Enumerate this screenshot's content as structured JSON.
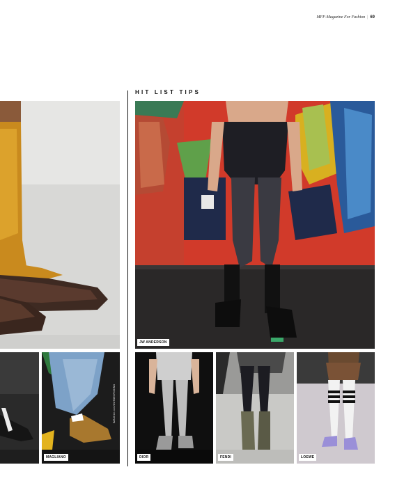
{
  "header": {
    "magazine": "MFF-Magazine For Fashion",
    "separator": "|",
    "page_number": "69"
  },
  "section_title": "HIT LIST TIPS",
  "credit": "IMAXtree.com/OUTDEXPOSING",
  "labels": {
    "jw_anderson": "JW ANDERSON",
    "magliano": "MAGLIANO",
    "dior": "DIOR",
    "fendi": "FENDI",
    "loewe": "LOEWE"
  }
}
